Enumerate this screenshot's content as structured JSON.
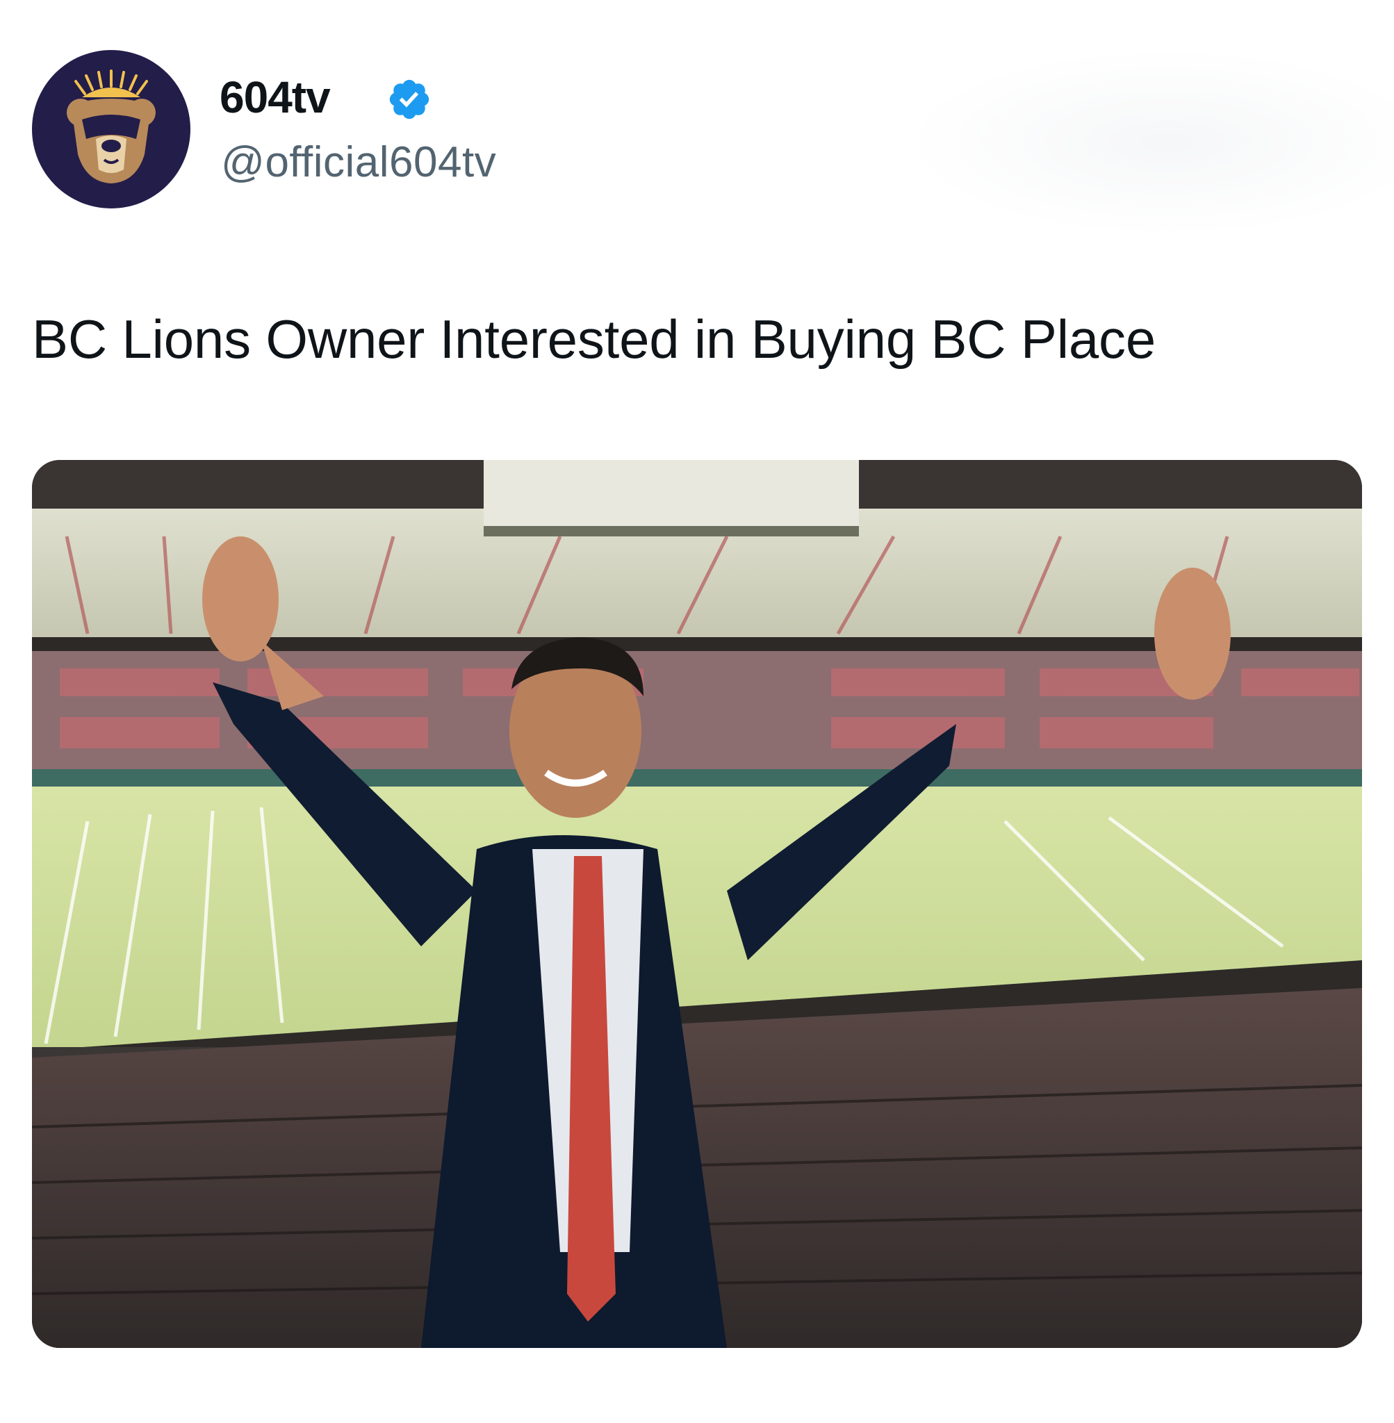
{
  "account": {
    "display_name": "604tv",
    "handle": "@official604tv",
    "verified": true,
    "avatar_icon": "bear-sun-logo-icon",
    "verified_icon": "verified-badge-icon"
  },
  "post": {
    "text": "BC Lions Owner Interested in Buying BC Place"
  },
  "media": {
    "kind": "photo",
    "subject": "man-arms-raised-in-stadium-photo"
  },
  "colors": {
    "avatar_bg": "#231d4a",
    "bear": "#b88a5a",
    "sun": "#f2c14e",
    "verified": "#1d9bf0",
    "handle": "#536471",
    "text": "#0f1419"
  }
}
